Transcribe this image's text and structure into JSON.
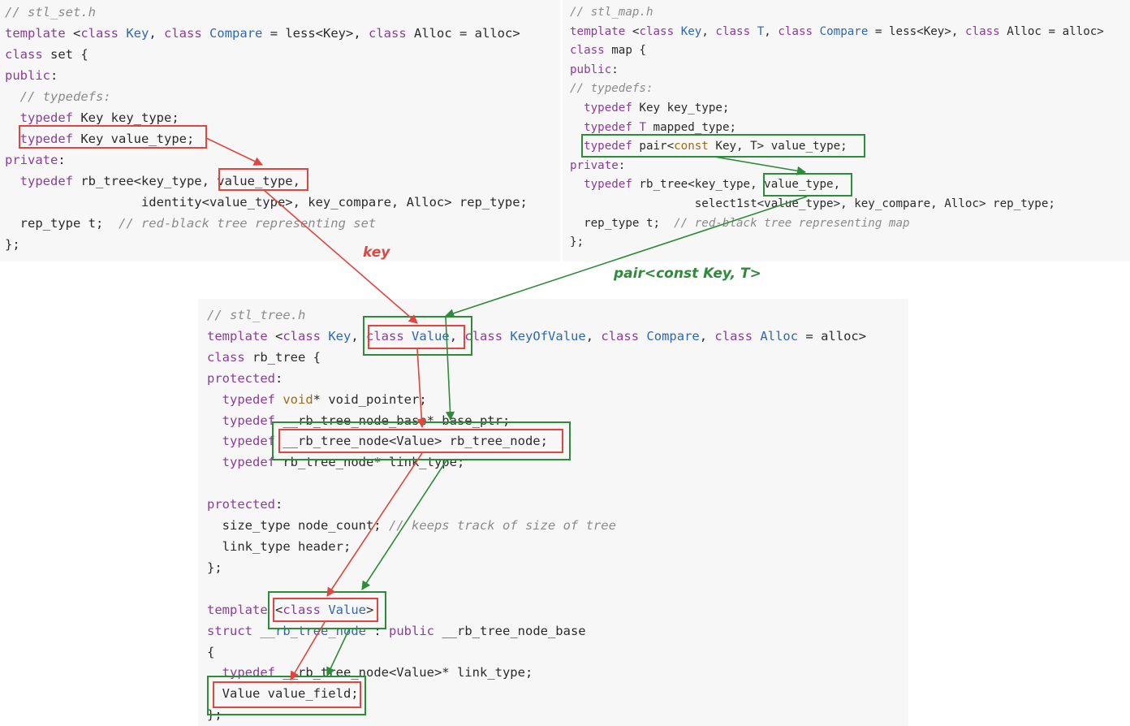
{
  "stl_set": {
    "lines": [
      "// stl_set.h",
      "template <class Key, class Compare = less<Key>, class Alloc = alloc>",
      "class set {",
      "public:",
      "  // typedefs:",
      "  typedef Key key_type;",
      "  typedef Key value_type;",
      "private:",
      "  typedef rb_tree<key_type, value_type,",
      "                  identity<value_type>, key_compare, Alloc> rep_type;",
      "  rep_type t;  // red-black tree representing set",
      "};"
    ]
  },
  "stl_map": {
    "lines": [
      "// stl_map.h",
      "template <class Key, class T, class Compare = less<Key>, class Alloc = alloc>",
      "class map {",
      "public:",
      "// typedefs:",
      "  typedef Key key_type;",
      "  typedef T mapped_type;",
      "  typedef pair<const Key, T> value_type;",
      "private:",
      "  typedef rb_tree<key_type, value_type,",
      "                  select1st<value_type>, key_compare, Alloc> rep_type;",
      "  rep_type t;  // red-black tree representing map",
      "};"
    ]
  },
  "stl_tree": {
    "lines": [
      "// stl_tree.h",
      "template <class Key, class Value, class KeyOfValue, class Compare, class Alloc = alloc>",
      "class rb_tree {",
      "protected:",
      "  typedef void* void_pointer;",
      "  typedef __rb_tree_node_base* base_ptr;",
      "  typedef __rb_tree_node<Value> rb_tree_node;",
      "  typedef rb_tree_node* link_type;",
      "",
      "protected:",
      "  size_type node_count; // keeps track of size of tree",
      "  link_type header;",
      "};",
      "",
      "template <class Value>",
      "struct __rb_tree_node : public __rb_tree_node_base",
      "{",
      "  typedef __rb_tree_node<Value>* link_type;",
      "  Value value_field;",
      "};"
    ]
  },
  "labels": {
    "set_flow": "key",
    "map_flow": "pair<const Key, T>"
  },
  "colors": {
    "set_flow": "#e0463f",
    "map_flow": "#2e8b3a",
    "keyword": "#8a3d99",
    "class_name": "#2f67b1",
    "comment": "#8b8b8b"
  }
}
